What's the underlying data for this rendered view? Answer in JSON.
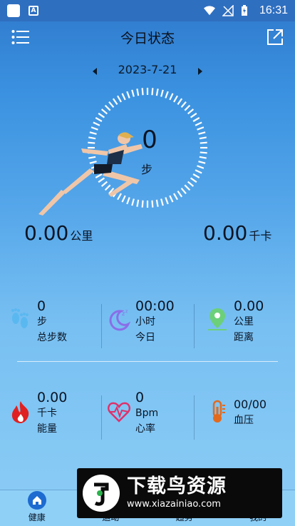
{
  "status_bar": {
    "time": "16:31"
  },
  "header": {
    "title": "今日状态"
  },
  "date_nav": {
    "date": "2023-7-21"
  },
  "ring": {
    "steps": "0",
    "unit": "步"
  },
  "summary": {
    "distance": {
      "value": "0.00",
      "unit": "公里"
    },
    "calories": {
      "value": "0.00",
      "unit": "千卡"
    }
  },
  "stats_row1": [
    {
      "value": "0",
      "unit": "步",
      "label": "总步数",
      "icon": "footprints-icon"
    },
    {
      "value": "00:00",
      "unit": "小时",
      "label": "今日",
      "icon": "sleep-moon-icon"
    },
    {
      "value": "0.00",
      "unit": "公里",
      "label": "距离",
      "icon": "location-pin-icon"
    }
  ],
  "stats_row2": [
    {
      "value": "0.00",
      "unit": "千卡",
      "label": "能量",
      "icon": "flame-icon"
    },
    {
      "value": "0",
      "unit": "Bpm",
      "label": "心率",
      "icon": "heart-rate-icon"
    },
    {
      "value": "00/00",
      "unit": "",
      "label": "血压",
      "icon": "thermometer-icon"
    }
  ],
  "bottom_nav": [
    {
      "label": "健康",
      "icon": "home-icon"
    },
    {
      "label": "运动",
      "icon": ""
    },
    {
      "label": "趋势",
      "icon": ""
    },
    {
      "label": "我的",
      "icon": ""
    }
  ],
  "watermark": {
    "title": "下载鸟资源",
    "url": "www.xiazainiao.com"
  },
  "colors": {
    "accent": "#1d6bd0",
    "header_bg": "#2f6fc0",
    "ring": "#ffffff"
  }
}
